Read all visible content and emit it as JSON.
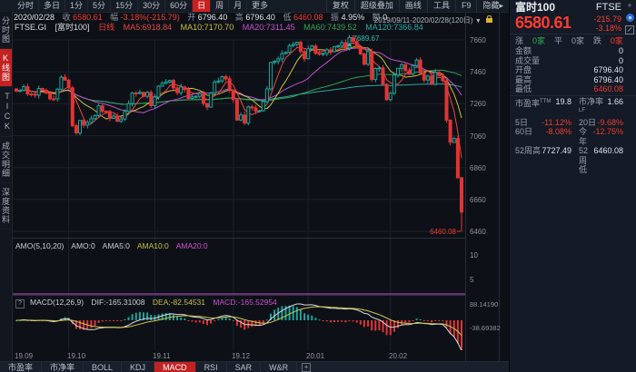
{
  "toolbar": {
    "tabs": [
      {
        "label": "分时"
      },
      {
        "label": "多日"
      },
      {
        "label": "1分"
      },
      {
        "label": "5分"
      },
      {
        "label": "15分"
      },
      {
        "label": "30分"
      },
      {
        "label": "60分"
      },
      {
        "label": "日",
        "selected": true
      },
      {
        "label": "周"
      },
      {
        "label": "月"
      },
      {
        "label": "更多"
      }
    ],
    "right_items": [
      {
        "label": "复权"
      },
      {
        "label": "超级叠加"
      },
      {
        "label": "画线"
      },
      {
        "label": "工具"
      },
      {
        "label": "F9"
      },
      {
        "label": "隐藏▸"
      }
    ]
  },
  "info_bar": {
    "date": "2020/02/28",
    "close_label": "收",
    "close": "6580.61",
    "chg_label": "幅",
    "chg": "-3.18%(-215.79)",
    "open_label": "开",
    "open": "6796.40",
    "high_label": "高",
    "high": "6796.40",
    "low_label": "低",
    "low": "6460.08",
    "amp_label": "振",
    "amp": "4.95%",
    "amt_label": "额",
    "amt": "0",
    "range": "2019/09/11-2020/02/28(120日)",
    "range_caret": "▼"
  },
  "ma_bar": {
    "symbol": "FTSE.GI",
    "name": "[富时100]",
    "period": "日线",
    "ma5": "MA5:6918.84",
    "ma10": "MA10:7170.70",
    "ma20": "MA20:7311.45",
    "ma60": "MA60:7439.52",
    "ma120": "MA120:7366.84"
  },
  "sidebar": {
    "items": [
      {
        "label": "分时图"
      },
      {
        "label": "K线图",
        "selected": true
      },
      {
        "label": "TICK"
      },
      {
        "label": "成交明细"
      },
      {
        "label": "深度资料"
      }
    ]
  },
  "amo_bar": {
    "title": "AMO(5,10,20)",
    "amo": "AMO:0",
    "ama5": "AMA5:0",
    "ama10": "AMA10:0",
    "ama20": "AMA20:0"
  },
  "macd_bar": {
    "help": "?",
    "title": "MACD(12,26,9)",
    "dif": "DIF:-165.31008",
    "dea": "DEA:-82.54531",
    "macd": "MACD:-165.52954"
  },
  "bottom_tabs": [
    {
      "label": "市盈率"
    },
    {
      "label": "市净率"
    },
    {
      "label": "BOLL"
    },
    {
      "label": "KDJ"
    },
    {
      "label": "MACD",
      "selected": true
    },
    {
      "label": "RSI"
    },
    {
      "label": "SAR"
    },
    {
      "label": "W&R"
    },
    {
      "label": "+"
    }
  ],
  "axis": {
    "y_ticks": [
      "7660",
      "7460",
      "7260",
      "7060",
      "6860",
      "6660",
      "6460"
    ],
    "vol_ticks": [
      "10",
      "5"
    ],
    "macd_ticks": [
      "88.14190",
      "-38.69382"
    ],
    "x_ticks": [
      {
        "label": "19.09",
        "idx": 0
      },
      {
        "label": "19.10",
        "idx": 14
      },
      {
        "label": "19.11",
        "idx": 37
      },
      {
        "label": "19.12",
        "idx": 58
      },
      {
        "label": "20.01",
        "idx": 78
      },
      {
        "label": "20.02",
        "idx": 100
      }
    ]
  },
  "quote_panel": {
    "name": "富时100",
    "code": "FTSE",
    "price": "6580.61",
    "change": "-215.79",
    "change_pct": "-3.18%",
    "adv_label": "涨",
    "adv": "0家",
    "flat_label": "平",
    "flat": "0家",
    "dec_label": "跌",
    "dec": "0家",
    "rows": [
      {
        "label": "金额",
        "value": "0"
      },
      {
        "label": "成交量",
        "value": "0"
      },
      {
        "label": "开盘",
        "value": "6796.40"
      },
      {
        "label": "最高",
        "value": "6796.40"
      },
      {
        "label": "最低",
        "value": "6460.08"
      }
    ],
    "pairs": [
      {
        "l1": "市盈率",
        "s1": "TTM",
        "v1": "19.8",
        "l2": "市净率",
        "s2": "LF",
        "v2": "1.66"
      },
      {
        "l1": "5日",
        "s1": "",
        "v1": "-11.12%",
        "l2": "20日",
        "s2": "",
        "v2": "-9.68%"
      },
      {
        "l1": "60日",
        "s1": "",
        "v1": "-8.08%",
        "l2": "今年",
        "s2": "",
        "v2": "-12.75%"
      },
      {
        "l1": "52周高",
        "s1": "",
        "v1": "7727.49",
        "l2": "52周低",
        "s2": "",
        "v2": "6460.08"
      }
    ]
  },
  "chart_data": {
    "type": "candlestick",
    "title": "FTSE.GI 富时100 日线",
    "date_range": "2019/09/11-2020/02/28 (120日)",
    "y_range": [
      6460,
      7660
    ],
    "closes": [
      7338,
      7344,
      7367,
      7321,
      7320,
      7314,
      7356,
      7345,
      7327,
      7291,
      7290,
      7351,
      7426,
      7408,
      7360,
      7122,
      7077,
      7155,
      7126,
      7143,
      7166,
      7186,
      7247,
      7213,
      7211,
      7168,
      7182,
      7150,
      7164,
      7212,
      7261,
      7328,
      7324,
      7331,
      7306,
      7331,
      7248,
      7302,
      7370,
      7388,
      7397,
      7406,
      7359,
      7329,
      7365,
      7351,
      7293,
      7303,
      7307,
      7324,
      7262,
      7239,
      7327,
      7396,
      7403,
      7429,
      7416,
      7346,
      7286,
      7158,
      7189,
      7138,
      7240,
      7234,
      7214,
      7216,
      7273,
      7353,
      7519,
      7525,
      7541,
      7574,
      7582,
      7624,
      7632,
      7645,
      7587,
      7542,
      7604,
      7622,
      7576,
      7573,
      7575,
      7598,
      7587,
      7618,
      7622,
      7643,
      7610,
      7675,
      7651,
      7611,
      7572,
      7508,
      7586,
      7412,
      7481,
      7484,
      7382,
      7286,
      7326,
      7440,
      7482,
      7505,
      7467,
      7446,
      7499,
      7534,
      7452,
      7409,
      7433,
      7382,
      7457,
      7437,
      7404,
      7157,
      7018,
      7042,
      6796.4,
      6580.61
    ],
    "last_candle": {
      "open": 6796.4,
      "high": 6796.4,
      "low": 6460.08,
      "close": 6580.61
    },
    "peak": {
      "index": 89,
      "high": 7689.67,
      "label": "7689.67"
    },
    "trough": {
      "index": 119,
      "low": 6460.08,
      "label": "6460.08"
    },
    "ma_periods": [
      5,
      10,
      20,
      60,
      120
    ],
    "macd_params": {
      "fast": 12,
      "slow": 26,
      "signal": 9,
      "dif": -165.31008,
      "dea": -82.54531,
      "macd": -165.52954
    },
    "colors": {
      "up": "#1ba49b",
      "down": "#e23434",
      "ma5": "#e84545",
      "ma10": "#c9bf3e",
      "ma20": "#c44fd0",
      "ma60": "#33a055",
      "ma120": "#26aaa5",
      "dif": "#d8dce2",
      "dea": "#cfc34a",
      "annotation_up": "#2cc0ae",
      "annotation_down": "#f03b30"
    }
  }
}
